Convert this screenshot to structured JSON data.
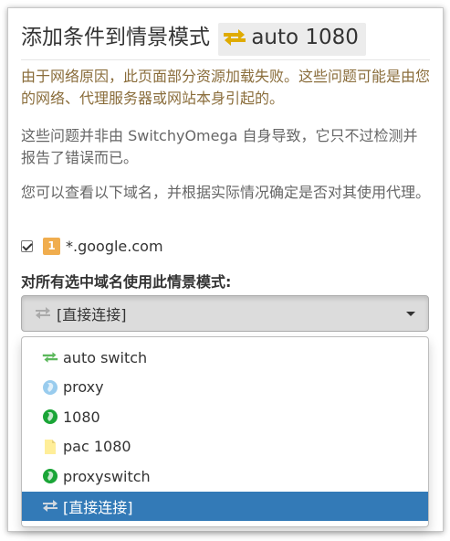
{
  "popup": {
    "title_prefix": "添加条件到情景模式",
    "profile_name": "auto 1080",
    "warning": "由于网络原因，此页面部分资源加载失败。这些问题可能是由您的网络、代理服务器或网站本身引起的。",
    "para1": "这些问题并非由 SwitchyOmega 自身导致，它只不过检测并报告了错误而已。",
    "para2": "您可以查看以下域名，并根据实际情况确定是否对其使用代理。",
    "domains": [
      {
        "badge": "1",
        "domain": "*.google.com",
        "checked": true
      }
    ],
    "select_label": "对所有选中域名使用此情景模式:",
    "selected_value": "[直接连接]",
    "options": [
      {
        "label": "auto switch",
        "icon": "auto-switch-icon",
        "color": "#5cb85c"
      },
      {
        "label": "proxy",
        "icon": "globe-icon",
        "color": "#99ccee"
      },
      {
        "label": "1080",
        "icon": "globe-icon",
        "color": "#1aa537"
      },
      {
        "label": "pac 1080",
        "icon": "file-icon",
        "color": "#ffee99"
      },
      {
        "label": "proxyswitch",
        "icon": "globe-icon",
        "color": "#1aa537"
      },
      {
        "label": "[直接连接]",
        "icon": "direct-icon",
        "color": "#aaaaaa",
        "selected": true
      }
    ]
  },
  "colors": {
    "accent": "#337ab7",
    "warning_text": "#8a6d3b",
    "badge": "#f0ad4e",
    "auto_icon": "#dfab01"
  }
}
